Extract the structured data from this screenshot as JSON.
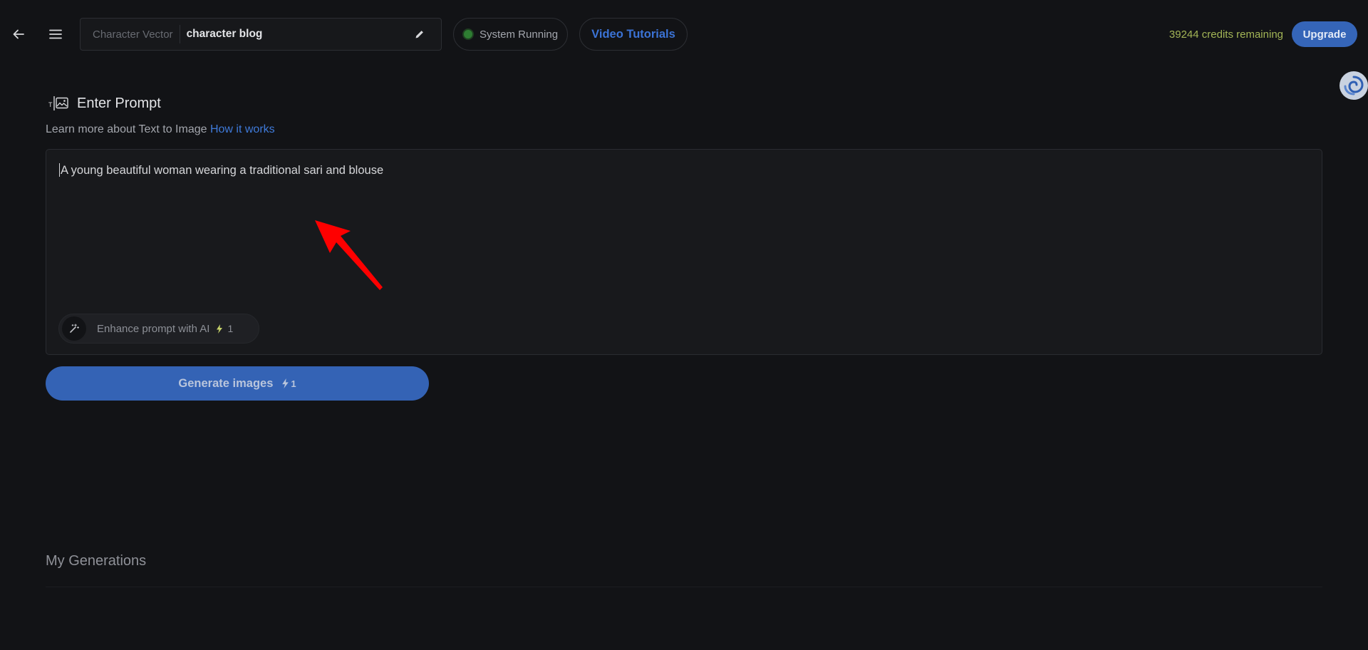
{
  "header": {
    "project_type": "Character Vector",
    "project_name": "character blog",
    "status": "System Running",
    "tutorials_label": "Video Tutorials",
    "credits": "39244 credits remaining",
    "upgrade_label": "Upgrade"
  },
  "prompt_section": {
    "title": "Enter Prompt",
    "learn_more_text": "Learn more about Text to Image",
    "learn_more_link": "How it works",
    "prompt_value": "A young beautiful woman wearing a traditional sari and blouse",
    "enhance_label": "Enhance prompt with AI",
    "enhance_cost": "1",
    "generate_label": "Generate images",
    "generate_cost": "1"
  },
  "generations": {
    "title": "My Generations"
  },
  "colors": {
    "background": "#121316",
    "accent": "#3565b8",
    "link": "#3f7ad9",
    "credits": "#a3b556",
    "status": "#2e7d32",
    "annotation": "#ff0000"
  }
}
